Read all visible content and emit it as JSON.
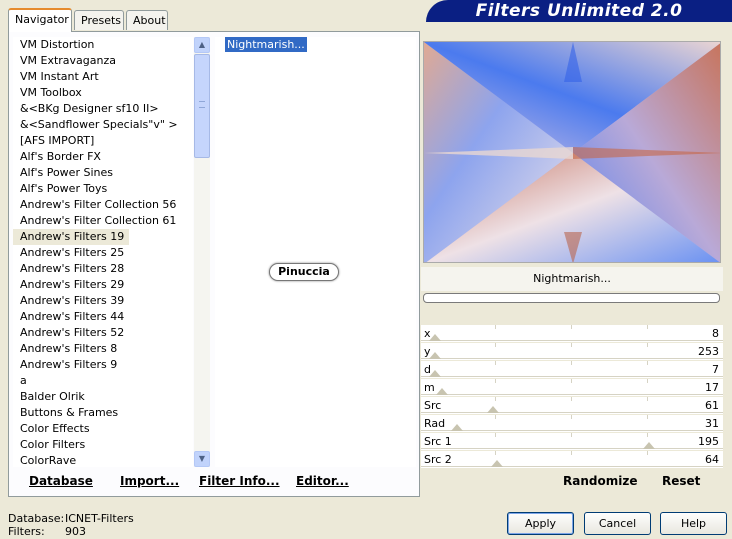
{
  "app": {
    "title": "Filters Unlimited 2.0"
  },
  "tabs": [
    {
      "label": "Navigator"
    },
    {
      "label": "Presets"
    },
    {
      "label": "About"
    }
  ],
  "categories": [
    "VM Distortion",
    "VM Extravaganza",
    "VM Instant Art",
    "VM Toolbox",
    "&<BKg Designer sf10 II>",
    "&<Sandflower Specials\"v\" >",
    "[AFS IMPORT]",
    "Alf's Border FX",
    "Alf's Power Sines",
    "Alf's Power Toys",
    "Andrew's Filter Collection 56",
    "Andrew's Filter Collection 61",
    "Andrew's Filters 19",
    "Andrew's Filters 25",
    "Andrew's Filters 28",
    "Andrew's Filters 29",
    "Andrew's Filters 39",
    "Andrew's Filters 44",
    "Andrew's Filters 52",
    "Andrew's Filters 8",
    "Andrew's Filters 9",
    "a",
    "Balder Olrik",
    "Buttons & Frames",
    "Color Effects",
    "Color Filters",
    "ColorRave"
  ],
  "selected_category": "Andrew's Filters 19",
  "selected_filter": "Nightmarish...",
  "watermark": "Pinuccia",
  "left_buttons": {
    "database": "Database",
    "import": "Import...",
    "filter_info": "Filter Info...",
    "editor": "Editor..."
  },
  "preview": {
    "filter_name": "Nightmarish...",
    "progress": 0
  },
  "params": [
    {
      "name": "x",
      "value": "8"
    },
    {
      "name": "y",
      "value": "253"
    },
    {
      "name": "d",
      "value": "7"
    },
    {
      "name": "m",
      "value": "17"
    },
    {
      "name": "Src",
      "value": "61"
    },
    {
      "name": "Rad",
      "value": "31"
    },
    {
      "name": "Src 1",
      "value": "195"
    },
    {
      "name": "Src 2",
      "value": "64"
    }
  ],
  "right_buttons": {
    "randomize": "Randomize",
    "reset": "Reset"
  },
  "status": {
    "database_label": "Database:",
    "database_value": "ICNET-Filters",
    "filters_label": "Filters:",
    "filters_value": "903"
  },
  "dialog_buttons": {
    "apply": "Apply",
    "cancel": "Cancel",
    "help": "Help"
  }
}
